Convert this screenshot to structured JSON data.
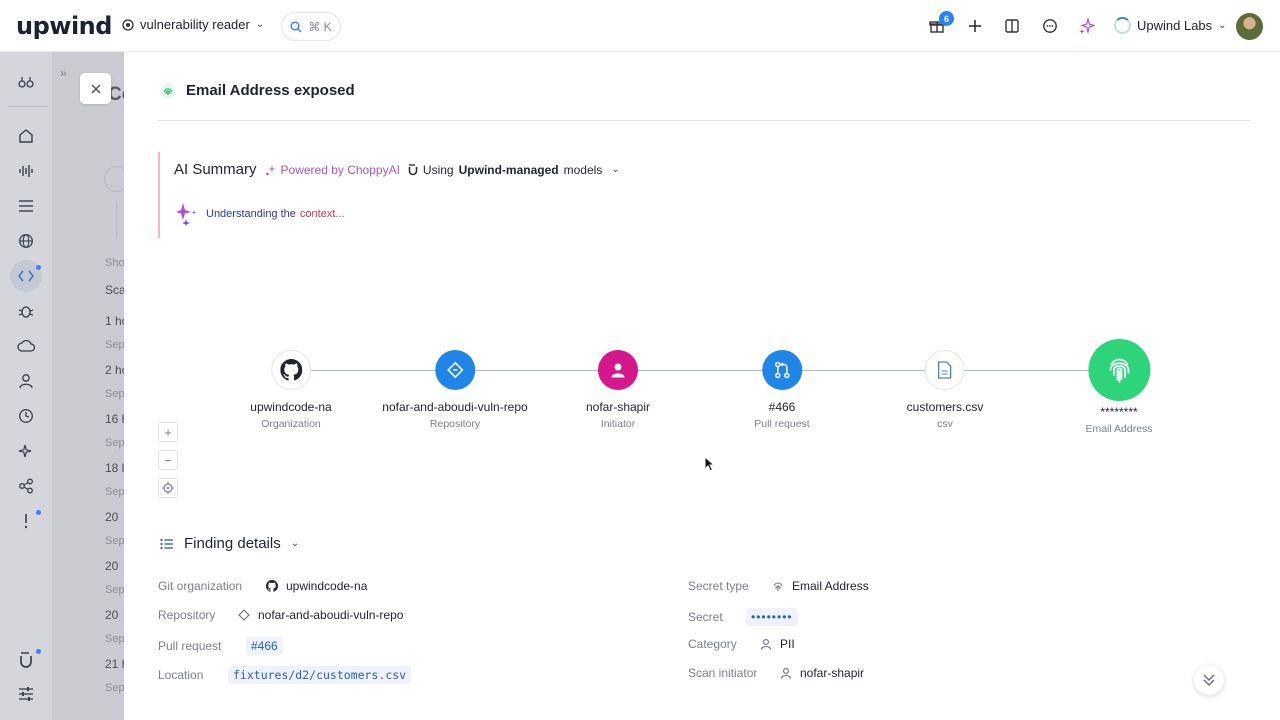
{
  "topbar": {
    "logo": "upwind",
    "scope_label": "vulnerability reader",
    "search_shortcut": "⌘ K",
    "notifications_count": "6",
    "org_name": "Upwind Labs"
  },
  "background_list": {
    "partial_title": "Co",
    "show_label": "Show",
    "scan_label": "Scan",
    "rows": [
      {
        "time": "1 ho",
        "sub": "Sep"
      },
      {
        "time": "2 ho",
        "sub": "Sep"
      },
      {
        "time": "16 h",
        "sub": "Sep"
      },
      {
        "time": "18 h",
        "sub": "Sep"
      },
      {
        "time": "20",
        "sub": "Sep"
      },
      {
        "time": "20",
        "sub": "Sep"
      },
      {
        "time": "20",
        "sub": "Sep"
      },
      {
        "time": "21 h",
        "sub": "Sep"
      }
    ]
  },
  "panel": {
    "title": "Email Address exposed",
    "ai_summary": {
      "title": "AI Summary",
      "powered_by": "Powered by ChoppyAI",
      "using_prefix": "Using",
      "using_bold": "Upwind-managed",
      "using_suffix": "models",
      "status_part1": "Understanding the",
      "status_part2": "context..."
    },
    "graph": {
      "nodes": [
        {
          "label": "upwindcode-na",
          "sub": "Organization",
          "color": "#ffffff",
          "icon": "github-icon"
        },
        {
          "label": "nofar-and-aboudi-vuln-repo",
          "sub": "Repository",
          "color": "#1f86e8",
          "icon": "repository-icon"
        },
        {
          "label": "nofar-shapir",
          "sub": "Initiator",
          "color": "#d6168b",
          "icon": "user-icon"
        },
        {
          "label": "#466",
          "sub": "Pull request",
          "color": "#1f86e8",
          "icon": "pull-request-icon"
        },
        {
          "label": "customers.csv",
          "sub": "csv",
          "color": "#ffffff",
          "icon": "file-icon"
        },
        {
          "label": "********",
          "sub": "Email Address",
          "color": "#2dd47a",
          "icon": "fingerprint-icon"
        }
      ]
    },
    "finding_details": {
      "title": "Finding details",
      "left": [
        {
          "key": "Git organization",
          "value": "upwindcode-na"
        },
        {
          "key": "Repository",
          "value": "nofar-and-aboudi-vuln-repo"
        },
        {
          "key": "Pull request",
          "value": "#466"
        },
        {
          "key": "Location",
          "value": "fixtures/d2/customers.csv"
        }
      ],
      "right": [
        {
          "key": "Secret type",
          "value": "Email Address"
        },
        {
          "key": "Secret",
          "value": "••••••••"
        },
        {
          "key": "Category",
          "value": "PII"
        },
        {
          "key": "Scan initiator",
          "value": "nofar-shapir"
        }
      ]
    }
  },
  "colors": {
    "accent_blue": "#1f86e8",
    "magenta": "#d6168b",
    "green": "#2dd47a",
    "purple": "#a855c9"
  }
}
